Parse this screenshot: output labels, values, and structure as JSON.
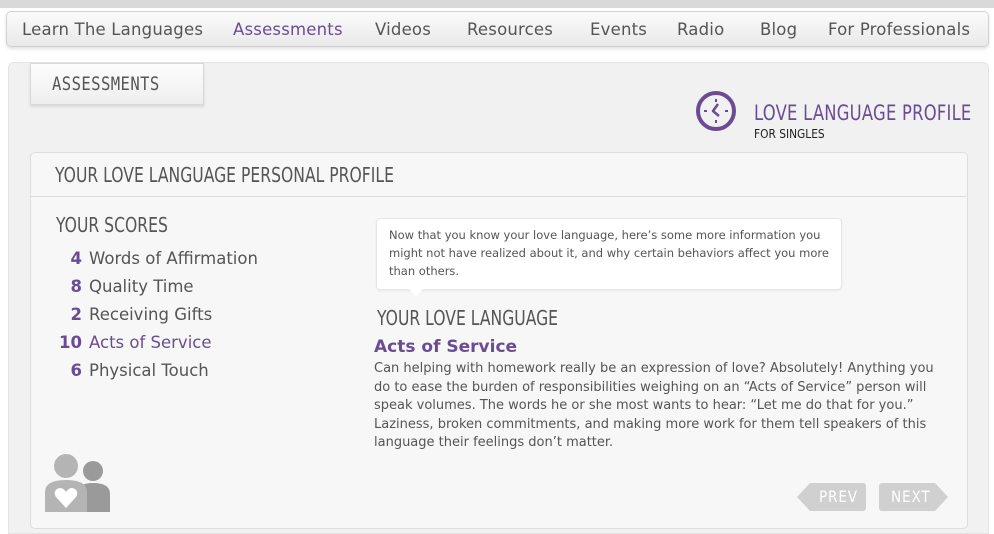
{
  "nav": {
    "items": [
      {
        "label": "Learn The Languages"
      },
      {
        "label": "Assessments"
      },
      {
        "label": "Videos"
      },
      {
        "label": "Resources"
      },
      {
        "label": "Events"
      },
      {
        "label": "Radio"
      },
      {
        "label": "Blog"
      },
      {
        "label": "For Professionals"
      }
    ],
    "active": "Assessments"
  },
  "section_tab": {
    "label": "ASSESSMENTS"
  },
  "profile_badge": {
    "icon": "clock-icon",
    "title": "LOVE LANGUAGE PROFILE",
    "subtitle": "FOR SINGLES"
  },
  "card": {
    "title": "YOUR LOVE LANGUAGE PERSONAL PROFILE"
  },
  "scores": {
    "title": "YOUR SCORES",
    "items": [
      {
        "score": "4",
        "label": "Words of Affirmation"
      },
      {
        "score": "8",
        "label": "Quality Time"
      },
      {
        "score": "2",
        "label": "Receiving Gifts"
      },
      {
        "score": "10",
        "label": "Acts of Service"
      },
      {
        "score": "6",
        "label": "Physical Touch"
      }
    ]
  },
  "bubble": {
    "text": "Now that you know your love language, here’s some more information you might not have realized about it, and why certain behaviors affect you more than others."
  },
  "love_language": {
    "heading": "YOUR LOVE LANGUAGE",
    "name": "Acts of Service",
    "description": "Can helping with homework really be an expression of love? Absolutely! Anything you do to ease the burden of responsibilities weighing on an “Acts of Service” person will speak volumes. The words he or she most wants to hear: “Let me do that for you.” Laziness, broken commitments, and making more work for them tell speakers of this language their feelings don’t matter."
  },
  "pager": {
    "prev_label": "PREV",
    "next_label": "NEXT"
  },
  "colors": {
    "accent": "#6b4c94",
    "text": "#555555",
    "button": "#d0d0d0"
  }
}
